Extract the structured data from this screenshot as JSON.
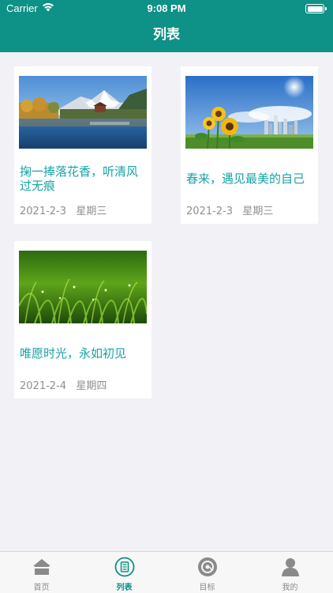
{
  "status_bar": {
    "carrier": "Carrier",
    "time": "9:08 PM"
  },
  "nav": {
    "title": "列表"
  },
  "posts": [
    {
      "title": "掬一捧落花香，听清风过无痕",
      "date": "2021-2-3",
      "weekday": "星期三",
      "image": "lake-mountain-photo"
    },
    {
      "title": "春来，遇见最美的自己",
      "date": "2021-2-3",
      "weekday": "星期三",
      "image": "sunflower-city-photo"
    },
    {
      "title": "唯愿时光，永如初见",
      "date": "2021-2-4",
      "weekday": "星期四",
      "image": "dewy-grass-photo"
    }
  ],
  "tabs": [
    {
      "label": "首页",
      "icon": "home-icon"
    },
    {
      "label": "列表",
      "icon": "list-icon",
      "active": true
    },
    {
      "label": "目标",
      "icon": "target-icon"
    },
    {
      "label": "我的",
      "icon": "user-icon"
    }
  ],
  "colors": {
    "accent": "#0e9187",
    "title": "#17a3a6",
    "date": "#8f8f8f"
  }
}
